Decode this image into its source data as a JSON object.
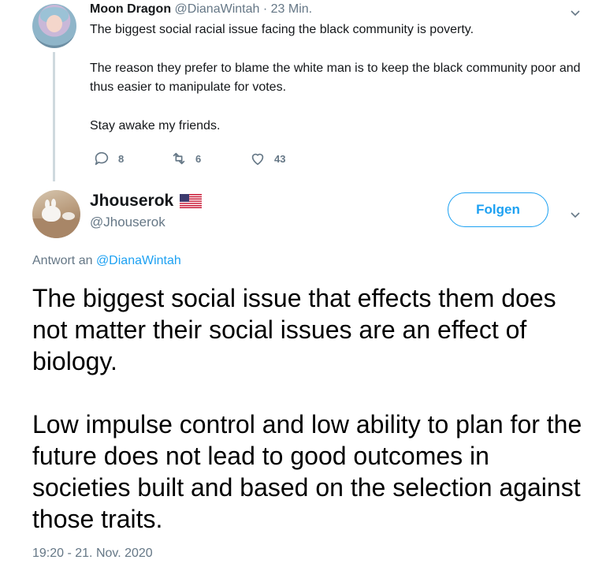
{
  "parent_tweet": {
    "display_name": "Moon Dragon",
    "handle": "@DianaWintah",
    "separator": "·",
    "time": "23 Min.",
    "paragraphs": [
      "The biggest social racial issue facing the black community is poverty.",
      "The reason they prefer to blame the white man is to keep the black community poor and thus easier to manipulate for votes.",
      "Stay awake my friends."
    ],
    "actions": {
      "replies": "8",
      "retweets": "6",
      "likes": "43"
    },
    "icons": {
      "reply": "reply-icon",
      "retweet": "retweet-icon",
      "like": "heart-icon",
      "more": "chevron-down-icon"
    }
  },
  "reply_tweet": {
    "display_name": "Jhouserok",
    "handle": "@Jhouserok",
    "flag_icon": "us-flag-icon",
    "follow_label": "Folgen",
    "reply_prefix": "Antwort an",
    "reply_handle": "@DianaWintah",
    "paragraphs": [
      "The biggest social issue that effects them does not matter their social issues are an effect of biology.",
      "Low impulse control and low ability to plan for the future does not lead to good outcomes in societies built and based on the selection against those traits."
    ],
    "timestamp": "19:20 - 21. Nov. 2020"
  },
  "colors": {
    "accent": "#1da1f2",
    "muted": "#657786",
    "text": "#14171a"
  }
}
